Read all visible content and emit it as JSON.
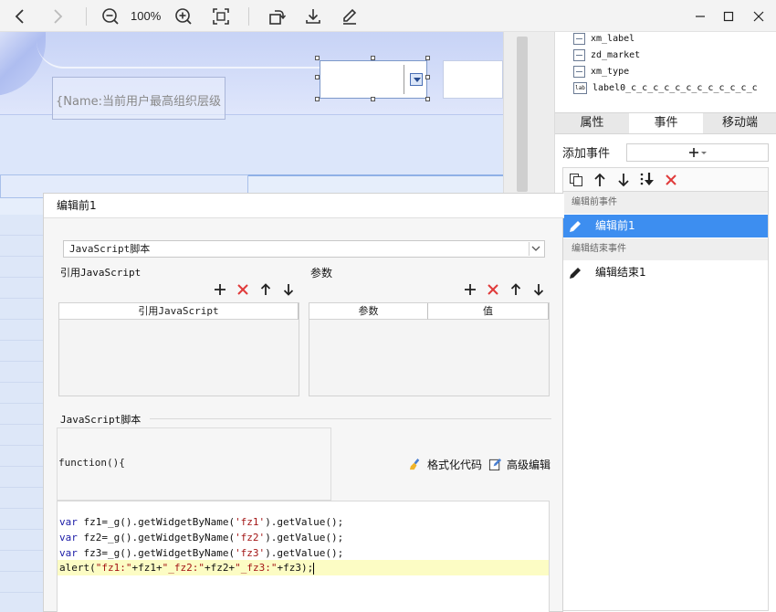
{
  "toolbar": {
    "zoom_label": "100%"
  },
  "canvas": {
    "label_widget_text": "{Name:当前用户最高组织层级"
  },
  "right_panel": {
    "tree_items": [
      {
        "name": "xm_label",
        "icon": "widget-icon"
      },
      {
        "name": "zd_market",
        "icon": "widget-icon"
      },
      {
        "name": "xm_type",
        "icon": "widget-icon"
      },
      {
        "name": "label0_c_c_c_c_c_c_c_c_c_c_c_c",
        "icon": "lab",
        "icon_text": "lab"
      }
    ],
    "tabs": [
      "属性",
      "事件",
      "移动端"
    ],
    "active_tab": "事件",
    "add_event_label": "添加事件",
    "groups": [
      {
        "title": "编辑前事件",
        "items": [
          {
            "label": "编辑前1",
            "selected": true
          }
        ]
      },
      {
        "title": "编辑结束事件",
        "items": [
          {
            "label": "编辑结束1",
            "selected": false
          }
        ]
      }
    ],
    "selected_color": "#3d8ef0"
  },
  "dialog": {
    "title": "编辑前1",
    "script_type": "JavaScript脚本",
    "ref_js_label": "引用JavaScript",
    "params_label": "参数",
    "ref_table_header": "引用JavaScript",
    "param_headers": [
      "参数",
      "值"
    ],
    "script_section_label": "JavaScript脚本",
    "function_signature": "function(){",
    "format_code_label": "格式化代码",
    "advanced_edit_label": "高级编辑",
    "code_lines": [
      {
        "kw": "var",
        "rest": " fz1=_g().getWidgetByName(",
        "str": "'fz1'",
        "tail": ").getValue();"
      },
      {
        "kw": "var",
        "rest": " fz2=_g().getWidgetByName(",
        "str": "'fz2'",
        "tail": ").getValue();"
      },
      {
        "kw": "var",
        "rest": " fz3=_g().getWidgetByName(",
        "str": "'fz3'",
        "tail": ").getValue();"
      }
    ],
    "code_last_line": {
      "a": "alert(",
      "s1": "\"fz1:\"",
      "b": "+fz1+",
      "s2": "\"_fz2:\"",
      "c": "+fz2+",
      "s3": "\"_fz3:\"",
      "d": "+fz3);"
    }
  }
}
